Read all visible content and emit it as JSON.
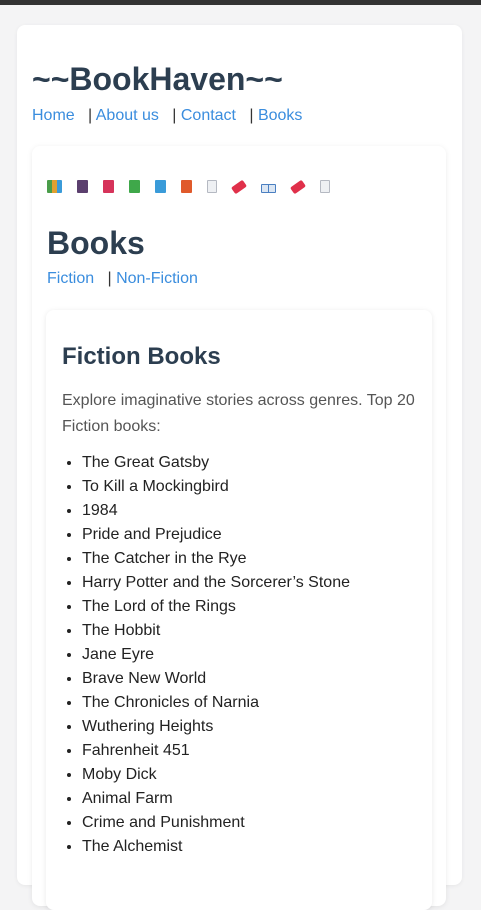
{
  "site": {
    "title": "~~BookHaven~~",
    "nav": [
      {
        "label": "Home"
      },
      {
        "label": "About us"
      },
      {
        "label": "Contact"
      },
      {
        "label": "Books"
      }
    ],
    "separator": "|"
  },
  "icons": [
    {
      "name": "books-stack-icon",
      "color": "#4a9d4a"
    },
    {
      "name": "notebook-icon",
      "color": "#5b3f6e"
    },
    {
      "name": "closed-book-red-icon",
      "color": "#d6335a"
    },
    {
      "name": "green-book-icon",
      "color": "#3fa84a"
    },
    {
      "name": "blue-book-icon",
      "color": "#3a9bd9"
    },
    {
      "name": "orange-book-icon",
      "color": "#e05a2b"
    },
    {
      "name": "page-icon",
      "color": "#b5b9c2"
    },
    {
      "name": "ticket-icon",
      "color": "#e0304a"
    },
    {
      "name": "open-book-icon",
      "color": "#4a7fc1"
    },
    {
      "name": "ticket-icon",
      "color": "#e0304a"
    },
    {
      "name": "page-icon",
      "color": "#b5b9c2"
    }
  ],
  "section": {
    "title": "Books",
    "subnav": [
      {
        "label": "Fiction"
      },
      {
        "label": "Non-Fiction"
      }
    ]
  },
  "fiction": {
    "title": "Fiction Books",
    "description": "Explore imaginative stories across genres. Top 20 Fiction books:",
    "books": [
      "The Great Gatsby",
      "To Kill a Mockingbird",
      "1984",
      "Pride and Prejudice",
      "The Catcher in the Rye",
      "Harry Potter and the Sorcerer’s Stone",
      "The Lord of the Rings",
      "The Hobbit",
      "Jane Eyre",
      "Brave New World",
      "The Chronicles of Narnia",
      "Wuthering Heights",
      "Fahrenheit 451",
      "Moby Dick",
      "Animal Farm",
      "Crime and Punishment",
      "The Alchemist"
    ]
  },
  "colors": {
    "heading": "#2c3e50",
    "link": "#3a8dde",
    "text": "#222222",
    "muted": "#555555",
    "background": "#f4f4f5"
  }
}
